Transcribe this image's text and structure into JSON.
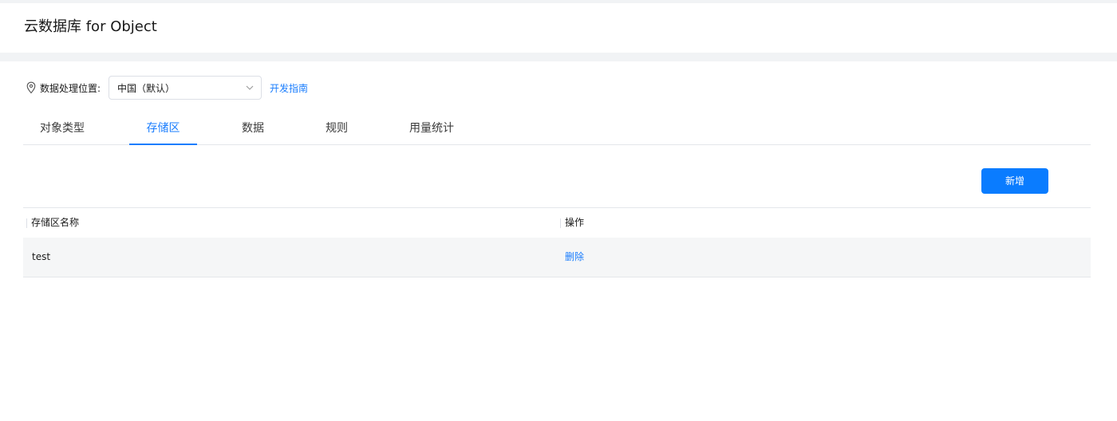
{
  "header": {
    "title": "云数据库 for Object"
  },
  "location": {
    "icon": "location-pin-icon",
    "label": "数据处理位置:",
    "selected": "中国（默认）",
    "dev_guide_link": "开发指南"
  },
  "tabs": [
    {
      "label": "对象类型",
      "active": false
    },
    {
      "label": "存储区",
      "active": true
    },
    {
      "label": "数据",
      "active": false
    },
    {
      "label": "规则",
      "active": false
    },
    {
      "label": "用量统计",
      "active": false
    }
  ],
  "toolbar": {
    "add_label": "新增"
  },
  "table": {
    "columns": [
      "存储区名称",
      "操作"
    ],
    "rows": [
      {
        "name": "test",
        "action": "删除"
      }
    ]
  },
  "colors": {
    "accent": "#1a7dfd",
    "primary_button": "#0a7cff"
  }
}
